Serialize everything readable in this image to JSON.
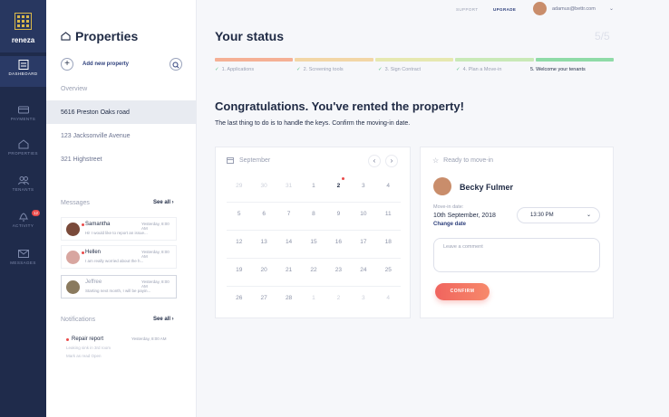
{
  "app": {
    "logo_text": "reneza",
    "brand_color": "#1f2b4b",
    "accent": "#d9b84a"
  },
  "nav": {
    "items": [
      {
        "label": "DASHBOARD",
        "icon": "dashboard-icon",
        "active": true
      },
      {
        "label": "PAYMENTS",
        "icon": "wallet-icon",
        "active": false
      },
      {
        "label": "PROPERTIES",
        "icon": "home-icon",
        "active": false
      },
      {
        "label": "TENANTS",
        "icon": "users-icon",
        "active": false
      },
      {
        "label": "ACTIVITY",
        "icon": "bell-icon",
        "active": false,
        "badge": "12"
      },
      {
        "label": "MESSAGES",
        "icon": "mail-icon",
        "active": false
      }
    ]
  },
  "properties_panel": {
    "title": "Properties",
    "add_label": "Add new property",
    "overview": "Overview",
    "properties": [
      "5616 Preston Oaks road",
      "123 Jacksonville Avenue",
      "321 Highstreet"
    ],
    "messages_heading": "Messages",
    "see_all": "See all",
    "messages": [
      {
        "name": "Samantha",
        "time": "Yesterday, 8:00 AM",
        "text": "Hi! I would like to report an issue...",
        "unread": true
      },
      {
        "name": "Hellen",
        "time": "Yesterday, 8:00 AM",
        "text": "I am really worried about the h...",
        "unread": true
      },
      {
        "name": "Jeffree",
        "time": "Yesterday, 8:00 AM",
        "text": "Starting next month, I will be payin...",
        "unread": false
      }
    ],
    "notifications_heading": "Notifications",
    "notification": {
      "title": "Repair report",
      "time": "Yesterday, 8:00 AM",
      "text": "Leaking sink in 3rd room",
      "mark_read": "Mark as read",
      "open": "Open"
    }
  },
  "topbar": {
    "support": "SUPPORT",
    "upgrade": "UPGRADE",
    "email": "adamus@bettr.com"
  },
  "status": {
    "title": "Your status",
    "count": "5/5",
    "steps": [
      {
        "label": "1. Applications",
        "done": true
      },
      {
        "label": "2. Screening tools",
        "done": true
      },
      {
        "label": "3. Sign Contract",
        "done": true
      },
      {
        "label": "4. Plan a Move-in",
        "done": true
      },
      {
        "label": "5. Welcome your tenants",
        "done": false
      }
    ],
    "progress_colors": [
      "#f5b095",
      "#f2d6a6",
      "#e6e8b0",
      "#c9e9b7",
      "#8fdba7"
    ]
  },
  "content": {
    "headline": "Congratulations. You've rented the property!",
    "subtext": "The last thing to do is to handle the keys. Confirm the moving-in date."
  },
  "calendar": {
    "month": "September",
    "weeks": [
      [
        "29",
        "30",
        "31",
        "1",
        "2",
        "3",
        "4"
      ],
      [
        "5",
        "6",
        "7",
        "8",
        "9",
        "10",
        "11"
      ],
      [
        "12",
        "13",
        "14",
        "15",
        "16",
        "17",
        "18"
      ],
      [
        "19",
        "20",
        "21",
        "22",
        "23",
        "24",
        "25"
      ],
      [
        "26",
        "27",
        "28",
        "1",
        "2",
        "3",
        "4"
      ]
    ],
    "today": "2"
  },
  "ready": {
    "heading": "Ready to move-in",
    "tenant_name": "Becky Fulmer",
    "movein_label": "Move-in date:",
    "movein_date": "10th September, 2018",
    "change_label": "Change date",
    "time": "13:30 PM",
    "comment_placeholder": "Leave a comment",
    "confirm_label": "CONFIRM"
  }
}
